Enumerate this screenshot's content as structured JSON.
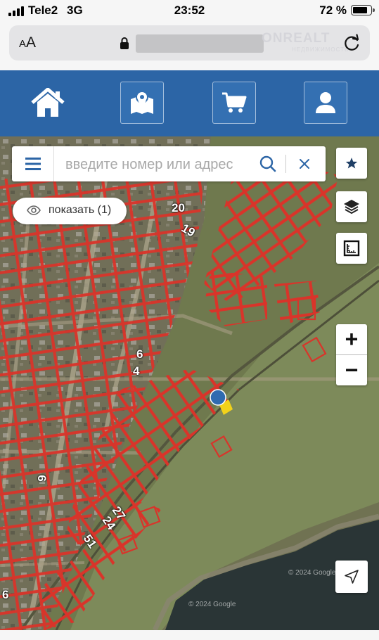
{
  "status_bar": {
    "carrier": "Tele2",
    "network": "3G",
    "time": "23:52",
    "battery_percent": "72 %"
  },
  "browser": {
    "text_size_label": "AA",
    "watermark": "ONREALT",
    "watermark_sub": "НЕДВИЖИМОСТЬ"
  },
  "nav": {
    "items": [
      {
        "icon": "home-icon"
      },
      {
        "icon": "map-pin-icon"
      },
      {
        "icon": "cart-icon"
      },
      {
        "icon": "user-icon"
      }
    ],
    "color": "#2c65a6"
  },
  "map": {
    "search": {
      "placeholder": "введите номер или адрес"
    },
    "show_button": {
      "label": "показать (1)"
    },
    "zoom_in": "+",
    "zoom_out": "−",
    "plot_labels": [
      "20",
      "19",
      "6",
      "4",
      "9",
      "27",
      "24",
      "51",
      "6"
    ],
    "attribution_1": "© 2024 Google",
    "attribution_2": "© 2024 Google",
    "boundary_color": "#e03a2c",
    "marker_color": "#2f6bb0",
    "highlight_color": "#f2d21b"
  }
}
